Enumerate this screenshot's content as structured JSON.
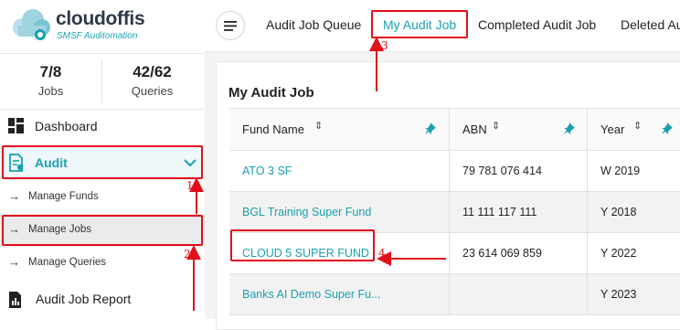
{
  "brand": {
    "name": "cloudoffis",
    "tagline": "SMSF Auditomation"
  },
  "stats": [
    {
      "value": "7/8",
      "label": "Jobs"
    },
    {
      "value": "42/62",
      "label": "Queries"
    }
  ],
  "nav": {
    "dashboard": "Dashboard",
    "audit": "Audit",
    "sub_items": [
      "Manage Funds",
      "Manage Jobs",
      "Manage Queries"
    ],
    "report": "Audit Job Report"
  },
  "tabs": [
    "Audit Job Queue",
    "My Audit Job",
    "Completed Audit Job",
    "Deleted Au"
  ],
  "active_tab": "My Audit Job",
  "page_title": "My Audit Job",
  "table": {
    "columns": [
      "Fund Name",
      "ABN",
      "Year"
    ],
    "rows": [
      {
        "fund": "ATO 3 SF",
        "abn": "79 781 076 414",
        "year": "W 2019"
      },
      {
        "fund": "BGL Training Super Fund",
        "abn": "11 111 117 111",
        "year": "Y 2018"
      },
      {
        "fund": "CLOUD 5 SUPER FUND",
        "abn": "23 614 069 859",
        "year": "Y 2022"
      },
      {
        "fund": "Banks AI Demo Super Fu...",
        "abn": "",
        "year": "Y 2023"
      }
    ]
  },
  "annotations": [
    "1",
    "2",
    "3",
    "4"
  ],
  "colors": {
    "accent": "#1a9fb0",
    "annotation": "#e0101a"
  }
}
